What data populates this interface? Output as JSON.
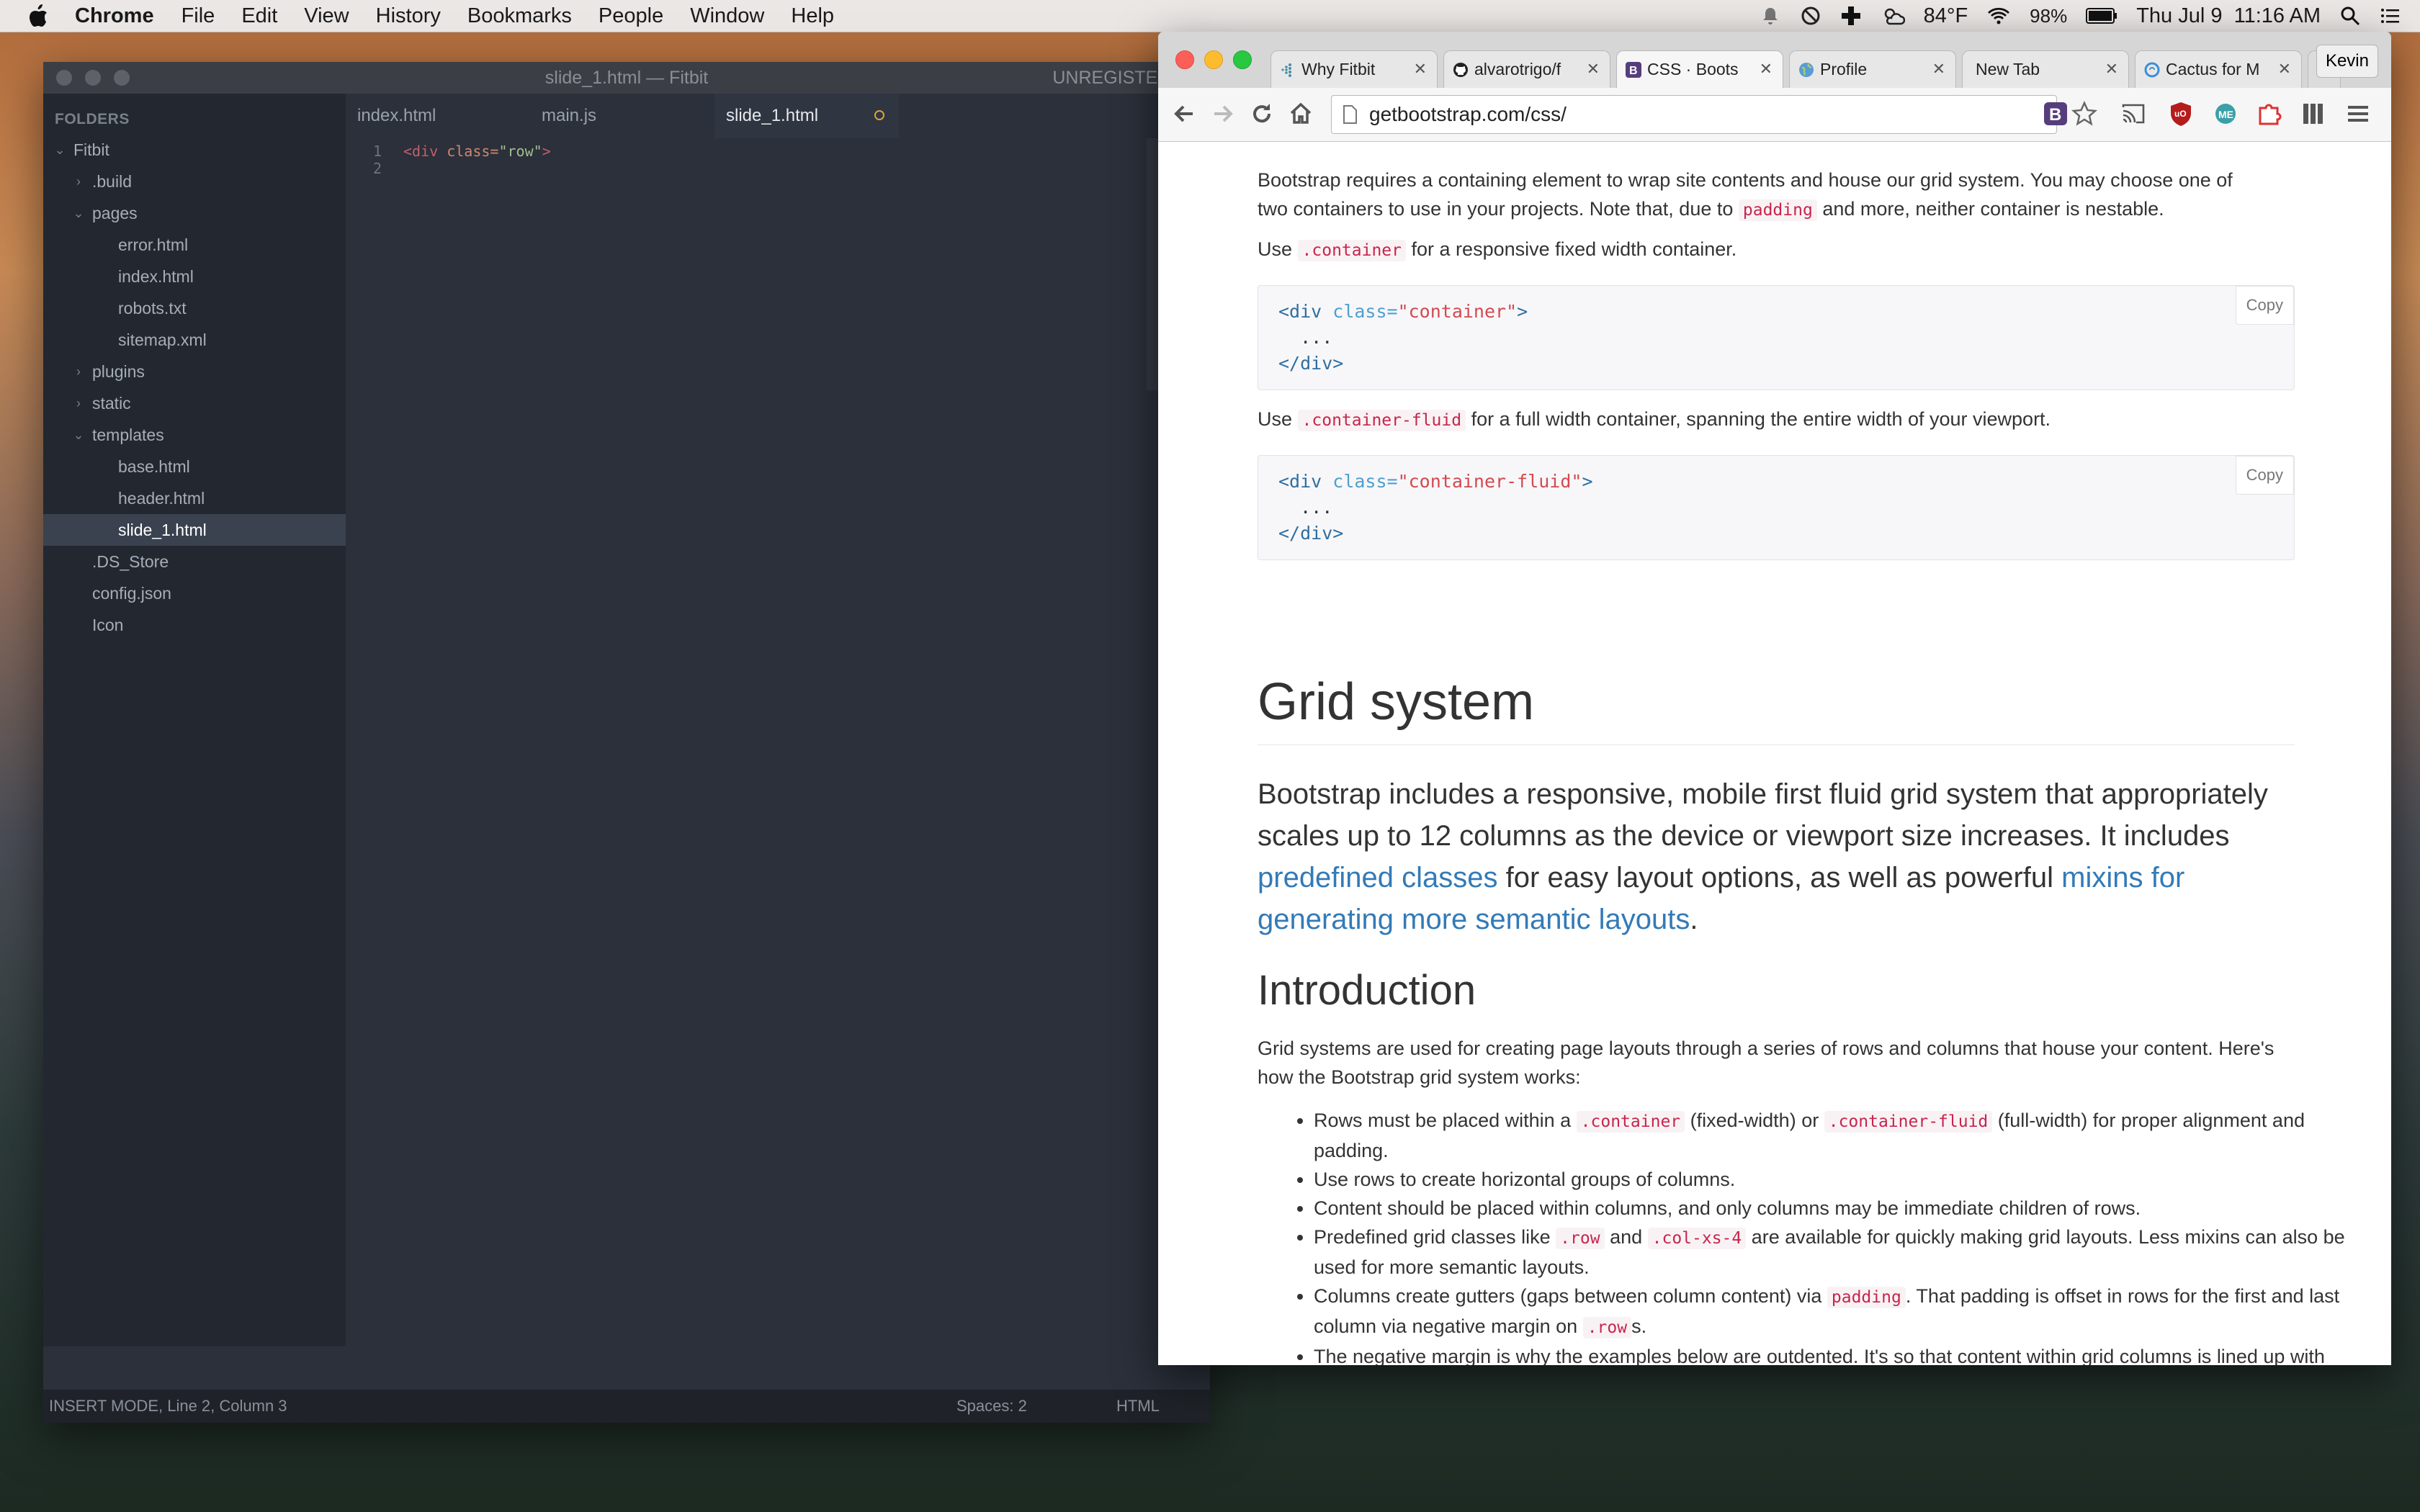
{
  "menubar": {
    "app": "Chrome",
    "items": [
      "File",
      "Edit",
      "View",
      "History",
      "Bookmarks",
      "People",
      "Window",
      "Help"
    ],
    "temperature": "84°F",
    "battery": "98%",
    "datetime": "Thu Jul 9  11:16 AM"
  },
  "editor": {
    "title": "slide_1.html — Fitbit",
    "unregistered": "UNREGISTERED",
    "sidebar_heading": "FOLDERS",
    "tree": [
      {
        "label": "Fitbit",
        "depth": 0,
        "arrow": "down"
      },
      {
        "label": ".build",
        "depth": 1,
        "arrow": "right"
      },
      {
        "label": "pages",
        "depth": 1,
        "arrow": "down"
      },
      {
        "label": "error.html",
        "depth": 2,
        "arrow": ""
      },
      {
        "label": "index.html",
        "depth": 2,
        "arrow": ""
      },
      {
        "label": "robots.txt",
        "depth": 2,
        "arrow": ""
      },
      {
        "label": "sitemap.xml",
        "depth": 2,
        "arrow": ""
      },
      {
        "label": "plugins",
        "depth": 1,
        "arrow": "right"
      },
      {
        "label": "static",
        "depth": 1,
        "arrow": "right"
      },
      {
        "label": "templates",
        "depth": 1,
        "arrow": "down"
      },
      {
        "label": "base.html",
        "depth": 2,
        "arrow": ""
      },
      {
        "label": "header.html",
        "depth": 2,
        "arrow": ""
      },
      {
        "label": "slide_1.html",
        "depth": 2,
        "arrow": "",
        "selected": true
      },
      {
        "label": ".DS_Store",
        "depth": 1,
        "arrow": ""
      },
      {
        "label": "config.json",
        "depth": 1,
        "arrow": ""
      },
      {
        "label": "Icon",
        "depth": 1,
        "arrow": ""
      }
    ],
    "tabs": [
      {
        "label": "index.html"
      },
      {
        "label": "main.js"
      },
      {
        "label": "slide_1.html",
        "active": true,
        "dirty": true
      }
    ],
    "code": {
      "line1_no": "1",
      "line2_no": "2",
      "tag_open": "<div",
      "attr": " class=",
      "value": "\"row\"",
      "tag_close": ">"
    },
    "status": {
      "mode": "INSERT MODE, Line 2, Column 3",
      "spaces": "Spaces: 2",
      "syntax": "HTML"
    }
  },
  "chrome": {
    "tabs": [
      {
        "label": "Why Fitbit",
        "icon": "fitbit-icon"
      },
      {
        "label": "alvarotrigo/f",
        "icon": "github-icon"
      },
      {
        "label": "CSS · Boots",
        "icon": "bootstrap-icon",
        "active": true
      },
      {
        "label": "Profile",
        "icon": "globe-icon"
      },
      {
        "label": "New Tab",
        "icon": ""
      },
      {
        "label": "Cactus for M",
        "icon": "cactus-icon"
      }
    ],
    "profile": "Kevin",
    "url": "getbootstrap.com/css/"
  },
  "page": {
    "intro_p1": "Bootstrap requires a containing element to wrap site contents and house our grid system. You may choose one of",
    "intro_p2a": "two containers to use in your projects. Note that, due to",
    "intro_p2_code": "padding",
    "intro_p2b": "and more, neither container is nestable.",
    "use1_a": "Use",
    "use1_code": ".container",
    "use1_b": "for a responsive fixed width container.",
    "code1": {
      "open": "<div",
      "attr": " class=",
      "val": "\"container\"",
      "close": ">",
      "dots": "  ...",
      "end": "</div>"
    },
    "copy": "Copy",
    "use2_a": "Use",
    "use2_code": ".container-fluid",
    "use2_b": "for a full width container, spanning the entire width of your viewport.",
    "code2": {
      "open": "<div",
      "attr": " class=",
      "val": "\"container-fluid\"",
      "close": ">",
      "dots": "  ...",
      "end": "</div>"
    },
    "h1": "Grid system",
    "lead_a": "Bootstrap includes a responsive, mobile first fluid grid system that appropriately scales up to 12 columns as the device or viewport size increases. It includes ",
    "lead_link1": "predefined classes",
    "lead_b": " for easy layout options, as well as powerful ",
    "lead_link2": "mixins for generating more semantic layouts",
    "lead_c": ".",
    "h2": "Introduction",
    "intro_text": "Grid systems are used for creating page layouts through a series of rows and columns that house your content. Here's how the Bootstrap grid system works:",
    "b1_a": "Rows must be placed within a ",
    "b1_c1": ".container",
    "b1_b": " (fixed-width) or ",
    "b1_c2": ".container-fluid",
    "b1_c": " (full-width) for proper alignment and padding.",
    "b2": "Use rows to create horizontal groups of columns.",
    "b3": "Content should be placed within columns, and only columns may be immediate children of rows.",
    "b4_a": "Predefined grid classes like ",
    "b4_c1": ".row",
    "b4_b": " and ",
    "b4_c2": ".col-xs-4",
    "b4_c": " are available for quickly making grid layouts. Less mixins can also be used for more semantic layouts.",
    "b5_a": "Columns create gutters (gaps between column content) via ",
    "b5_c1": "padding",
    "b5_b": ". That padding is offset in rows for the first and last column via negative margin on ",
    "b5_c2": ".row",
    "b5_c": "s.",
    "b6": "The negative margin is why the examples below are outdented. It's so that content within grid columns is lined up with non-grid content."
  }
}
